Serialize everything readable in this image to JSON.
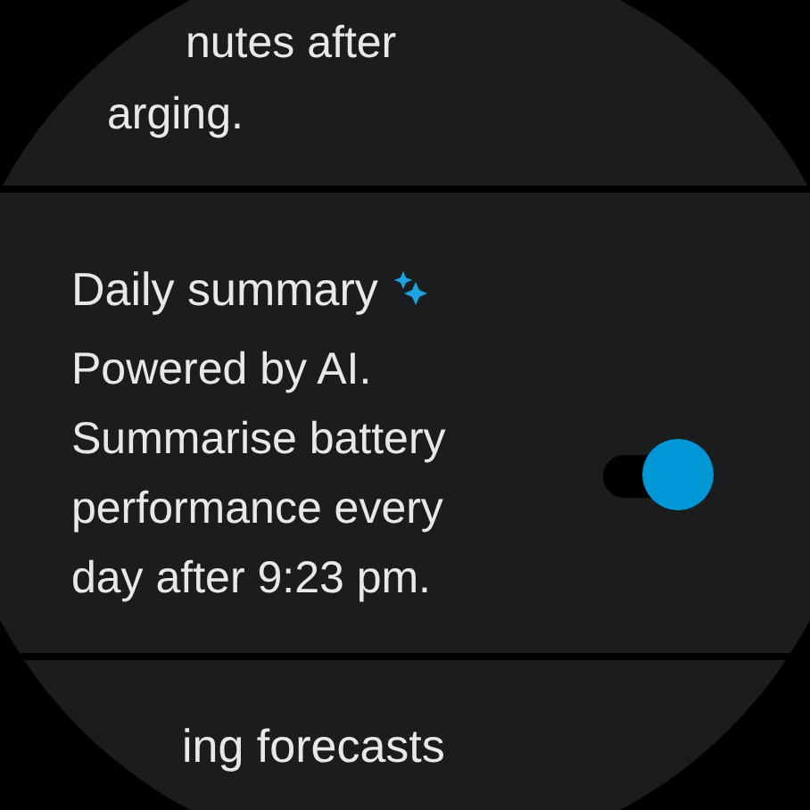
{
  "previous_item": {
    "description_lines": [
      "nutes after",
      "arging."
    ]
  },
  "daily_summary": {
    "title": "Daily summary",
    "description": "Powered by AI. Summarise battery performance every day after 9:23 pm.",
    "on": true
  },
  "next_item": {
    "title": "ing forecasts"
  }
}
